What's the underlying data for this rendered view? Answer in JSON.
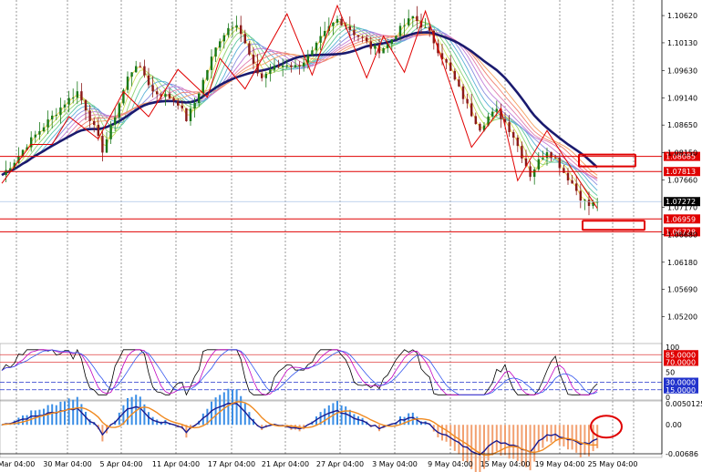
{
  "chart_data": [
    {
      "type": "candlestick",
      "panel": "price",
      "ylim": [
        1.0475,
        1.109
      ],
      "y_ticks": [
        "1.10620",
        "1.10130",
        "1.09630",
        "1.09140",
        "1.08650",
        "1.08150",
        "1.07660",
        "1.07170",
        "1.06680",
        "1.06180",
        "1.05690",
        "1.05200"
      ],
      "x_ticks": [
        "Mar 04:00",
        "30 Mar 04:00",
        "5 Apr 04:00",
        "11 Apr 04:00",
        "17 Apr 04:00",
        "21 Apr 04:00",
        "27 Apr 04:00",
        "3 May 04:00",
        "9 May 04:00",
        "15 May 04:00",
        "19 May 04:00",
        "25 May 04:00"
      ],
      "close_path": [
        [
          0,
          1.0775
        ],
        [
          3,
          1.08
        ],
        [
          6,
          1.083
        ],
        [
          9,
          1.0855
        ],
        [
          12,
          1.088
        ],
        [
          15,
          1.0905
        ],
        [
          18,
          1.0925
        ],
        [
          20,
          1.0895
        ],
        [
          22,
          1.086
        ],
        [
          24,
          1.082
        ],
        [
          26,
          1.086
        ],
        [
          28,
          1.0905
        ],
        [
          30,
          1.095
        ],
        [
          32,
          1.0975
        ],
        [
          34,
          1.0955
        ],
        [
          36,
          1.0925
        ],
        [
          38,
          1.092
        ],
        [
          40,
          1.0915
        ],
        [
          42,
          1.0905
        ],
        [
          44,
          1.0875
        ],
        [
          46,
          1.0905
        ],
        [
          48,
          1.0945
        ],
        [
          50,
          1.0985
        ],
        [
          52,
          1.102
        ],
        [
          54,
          1.104
        ],
        [
          56,
          1.105
        ],
        [
          58,
          1.101
        ],
        [
          60,
          1.097
        ],
        [
          62,
          1.095
        ],
        [
          64,
          1.0965
        ],
        [
          66,
          1.097
        ],
        [
          68,
          1.0975
        ],
        [
          70,
          1.097
        ],
        [
          72,
          1.098
        ],
        [
          74,
          1.0995
        ],
        [
          76,
          1.102
        ],
        [
          78,
          1.104
        ],
        [
          80,
          1.1055
        ],
        [
          82,
          1.1045
        ],
        [
          84,
          1.103
        ],
        [
          86,
          1.102
        ],
        [
          88,
          1.1005
        ],
        [
          90,
          1.1
        ],
        [
          92,
          1.101
        ],
        [
          94,
          1.103
        ],
        [
          96,
          1.1045
        ],
        [
          98,
          1.106
        ],
        [
          100,
          1.1045
        ],
        [
          102,
          1.103
        ],
        [
          104,
          1.1
        ],
        [
          106,
          1.0975
        ],
        [
          108,
          1.0945
        ],
        [
          110,
          1.0915
        ],
        [
          112,
          1.0885
        ],
        [
          114,
          1.086
        ],
        [
          116,
          1.088
        ],
        [
          118,
          1.089
        ],
        [
          120,
          1.087
        ],
        [
          122,
          1.0845
        ],
        [
          124,
          1.081
        ],
        [
          126,
          1.0775
        ],
        [
          128,
          1.08
        ],
        [
          130,
          1.082
        ],
        [
          132,
          1.0805
        ],
        [
          134,
          1.078
        ],
        [
          136,
          1.076
        ],
        [
          138,
          1.0735
        ],
        [
          140,
          1.072
        ],
        [
          142,
          1.0727
        ]
      ],
      "highs": [
        1.083,
        1.088,
        1.0925,
        1.0965,
        1.0985,
        1.1065,
        1.108,
        1.1025,
        1.107,
        1.0895
      ],
      "lows": [
        1.076,
        1.083,
        1.084,
        1.088,
        1.0915,
        1.093,
        1.0955,
        1.095,
        1.096,
        1.0825,
        1.0765,
        1.0715
      ],
      "horizontal_levels": [
        {
          "value": 1.08085,
          "label": "1.08085"
        },
        {
          "value": 1.07813,
          "label": "1.07813"
        },
        {
          "value": 1.06959,
          "label": "1.06959"
        },
        {
          "value": 1.06728,
          "label": "1.06728"
        }
      ],
      "current_price": {
        "value": 1.07272,
        "label": "1.07272"
      }
    },
    {
      "type": "line",
      "panel": "rsi",
      "ylim": [
        0,
        100
      ],
      "y_ticks": [
        "100",
        "50",
        "0"
      ],
      "levels": [
        {
          "value": 85,
          "label": "85.0000"
        },
        {
          "value": 70,
          "label": "70.0000"
        },
        {
          "value": 30,
          "label": "30.0000"
        },
        {
          "value": 15,
          "label": "15.0000"
        }
      ]
    },
    {
      "type": "bar",
      "panel": "macd",
      "ylim": [
        -0.00686,
        0.00501
      ],
      "y_ticks": [
        "0.00501250",
        "0.00",
        "-0.00686"
      ]
    }
  ]
}
